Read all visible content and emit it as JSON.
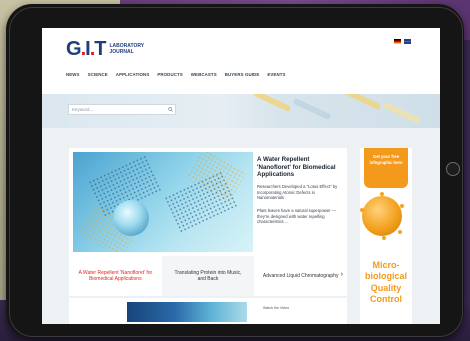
{
  "logo": {
    "name": "G.I.T",
    "subtitle": "LABORATORY JOURNAL"
  },
  "languages": [
    "de-flag-icon",
    "gb-flag-icon"
  ],
  "nav": [
    "NEWS",
    "SCIENCE",
    "APPLICATIONS",
    "PRODUCTS",
    "WEBCASTS",
    "BUYERS GUIDE",
    "EVENTS"
  ],
  "search": {
    "placeholder": "Keyword..."
  },
  "feature": {
    "title": "A Water Repellent 'Nanofloret' for Biomedical Applications",
    "text1": "Researchers Developed a \"Lotus Effect\" by Incorporating Atomic Defects in Nanomaterials",
    "text2": "Plant leaves have a natural superpower — they're designed with water repelling characteristics ..."
  },
  "tabs": [
    "A Water Repellent 'Nanofloret' for Biomedical Applications",
    "Translating Protein into Music, and Back",
    "Advanced Liquid Chromatography"
  ],
  "strip": {
    "text": "Watch the Video"
  },
  "ad": {
    "badge": "Get your free infographic here",
    "line1": "Micro-",
    "line2": "biological",
    "line3": "Quality",
    "line4": "Control"
  },
  "colors": {
    "brand": "#1f3f7a",
    "accent": "#e2261c",
    "ad_orange": "#f39a1c"
  }
}
